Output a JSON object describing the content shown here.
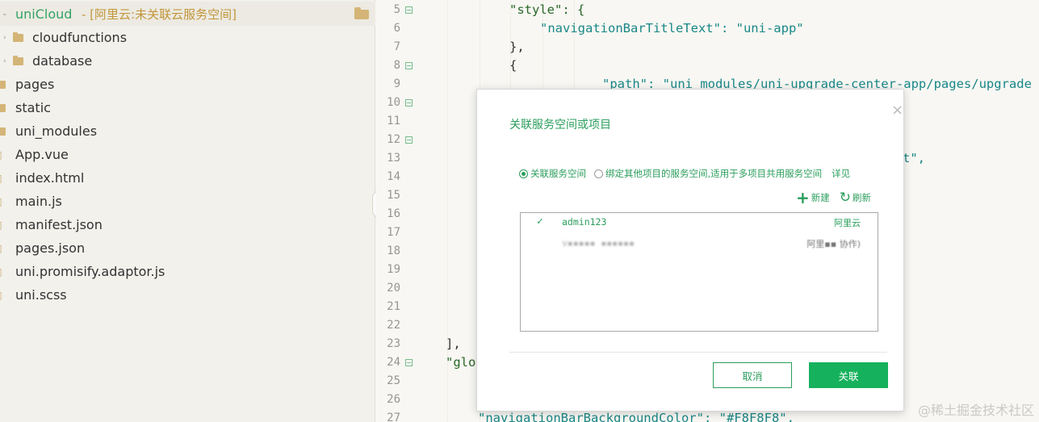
{
  "sidebar": {
    "root": {
      "name": "uniCloud",
      "sub": "- [阿里云:未关联云服务空间]"
    },
    "items": [
      {
        "label": "cloudfunctions",
        "kind": "folder"
      },
      {
        "label": "database",
        "kind": "folder"
      },
      {
        "label": "pages",
        "kind": "folder"
      },
      {
        "label": "static",
        "kind": "folder"
      },
      {
        "label": "uni_modules",
        "kind": "folder"
      },
      {
        "label": "App.vue",
        "kind": "file"
      },
      {
        "label": "index.html",
        "kind": "file"
      },
      {
        "label": "main.js",
        "kind": "file"
      },
      {
        "label": "manifest.json",
        "kind": "file"
      },
      {
        "label": "pages.json",
        "kind": "file"
      },
      {
        "label": "uni.promisify.adaptor.js",
        "kind": "file"
      },
      {
        "label": "uni.scss",
        "kind": "file"
      }
    ]
  },
  "editor": {
    "line_numbers": [
      "5",
      "6",
      "7",
      "8",
      "9",
      "10",
      "11",
      "12",
      "13",
      "14",
      "15",
      "16",
      "17",
      "18",
      "19",
      "20",
      "21",
      "22",
      "23",
      "24",
      "25",
      "26",
      "27"
    ],
    "code": {
      "l5": "\"style\": {",
      "l6": "\"navigationBarTitleText\": \"uni-app\"",
      "l7": "},",
      "l8": "{",
      "l9": "\"path\": \"uni_modules/uni-upgrade-center-app/pages/upgrade",
      "l13": "t\",",
      "l23": "],",
      "l24": "\"glo",
      "l27": "\"navigationBarBackgroundColor\": \"#F8F8F8\","
    }
  },
  "dialog": {
    "title": "关联服务空间或项目",
    "close": "×",
    "radio_link_space": "关联服务空间",
    "radio_bind_other": "绑定其他项目的服务空间,适用于多项目共用服务空间",
    "detail_link": "详见",
    "new_label": "新建",
    "refresh_label": "刷新",
    "spaces": [
      {
        "name": "admin123",
        "provider": "阿里云",
        "selected": true
      },
      {
        "name": "v▪▪▪▪▪ ▪▪▪▪▪▪",
        "provider": "阿里▪▪ 协作)",
        "selected": false
      }
    ],
    "cancel_label": "取消",
    "ok_label": "关联"
  },
  "watermark": "@稀土掘金技术社区",
  "colors": {
    "accent": "#2a9d5c",
    "button_green": "#16b15c"
  }
}
